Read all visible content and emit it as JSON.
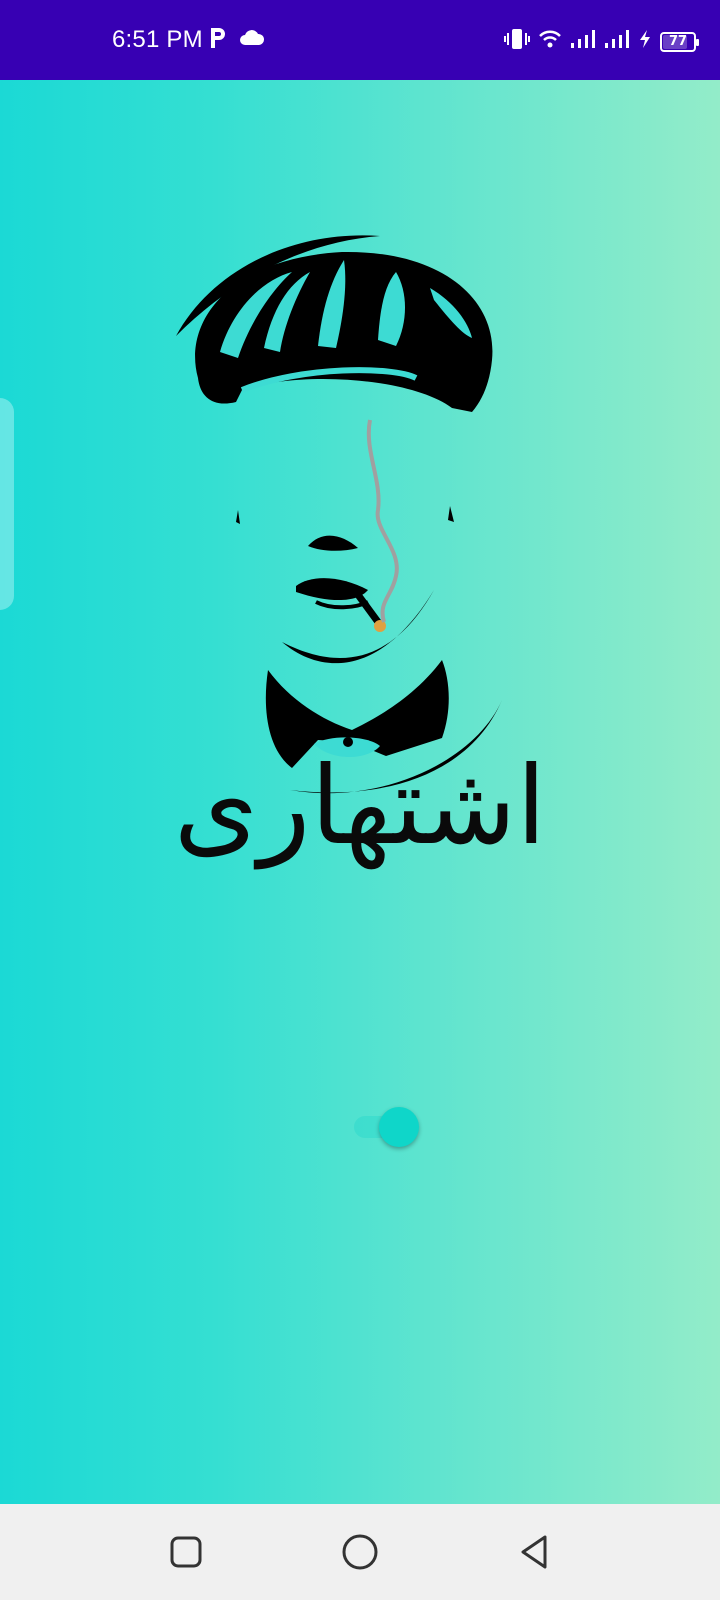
{
  "status_bar": {
    "time": "6:51 PM",
    "left_icons": [
      "p-app-icon",
      "cloud-icon"
    ],
    "right_icons": [
      "vibrate-icon",
      "wifi-icon",
      "signal-1-icon",
      "signal-2-icon",
      "charging-icon",
      "battery-icon"
    ],
    "battery_level": "77",
    "background": "#3700b3"
  },
  "app": {
    "title": "اشتهاری",
    "logo": "peaky-blinders-man-with-cap-and-cigarette",
    "background_gradient": [
      "#1bd9d5",
      "#93ecc9"
    ],
    "loading_toggle_state": "on",
    "toggle_color": "#0fd6c9"
  },
  "nav_bar": {
    "buttons": [
      "recents-button",
      "home-button",
      "back-button"
    ]
  }
}
